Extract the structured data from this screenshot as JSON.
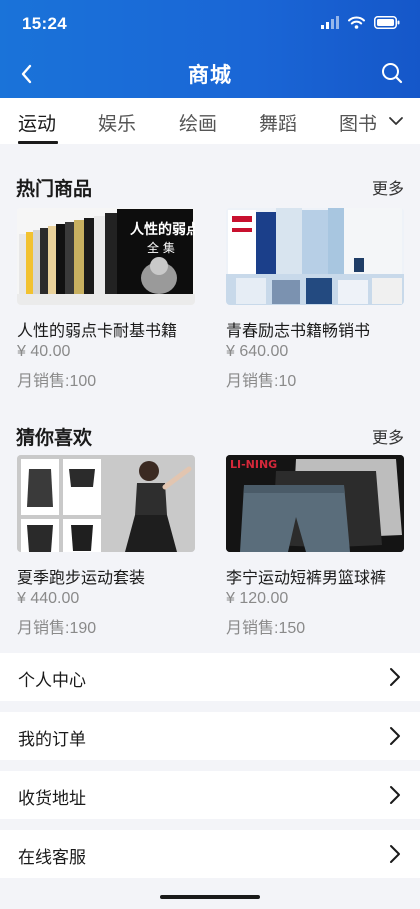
{
  "status_bar": {
    "time": "15:24"
  },
  "nav": {
    "title": "商城"
  },
  "tabs": [
    {
      "label": "运动",
      "active": true
    },
    {
      "label": "娱乐",
      "active": false
    },
    {
      "label": "绘画",
      "active": false
    },
    {
      "label": "舞蹈",
      "active": false
    },
    {
      "label": "图书",
      "active": false
    }
  ],
  "hot": {
    "title": "热门商品",
    "more": "更多",
    "items": [
      {
        "name": "人性的弱点卡耐基书籍",
        "price": "¥ 40.00",
        "sales": "月销售:100",
        "cover_text_1": "人性的弱点",
        "cover_text_2": "全 集"
      },
      {
        "name": "青春励志书籍畅销书",
        "price": "¥ 640.00",
        "sales": "月销售:10"
      }
    ]
  },
  "guess": {
    "title": "猜你喜欢",
    "more": "更多",
    "items": [
      {
        "name": "夏季跑步运动套装",
        "price": "¥ 440.00",
        "sales": "月销售:190"
      },
      {
        "name": "李宁运动短裤男篮球裤",
        "price": "¥ 120.00",
        "sales": "月销售:150",
        "brand_text": "LI-NING"
      }
    ]
  },
  "menu": [
    {
      "label": "个人中心"
    },
    {
      "label": "我的订单"
    },
    {
      "label": "收货地址"
    },
    {
      "label": "在线客服"
    }
  ],
  "colors": {
    "header_blue": "#1a6ad8",
    "page_bg": "#f3f4f8"
  }
}
